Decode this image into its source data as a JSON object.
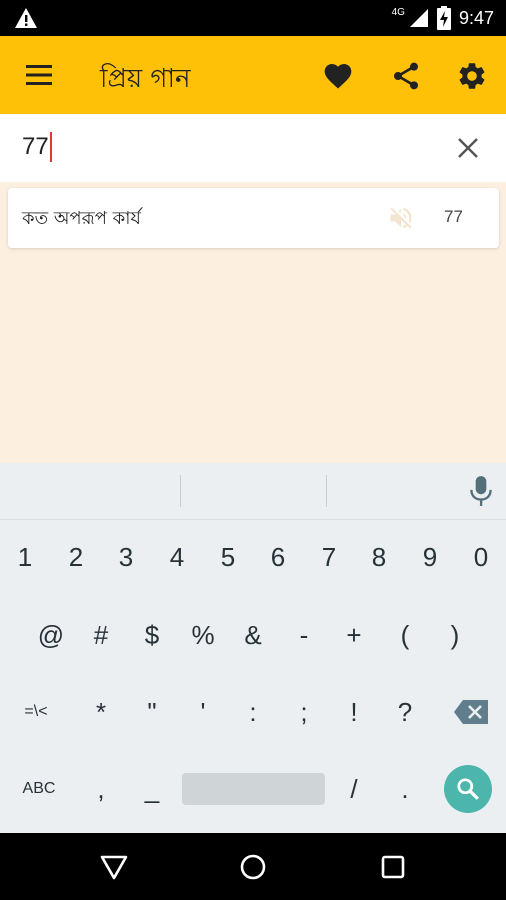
{
  "status_bar": {
    "network": "4G",
    "time": "9:47"
  },
  "app_bar": {
    "title": "প্রিয় গান"
  },
  "search": {
    "value": "77"
  },
  "results": [
    {
      "title": "কত অপরূপ কার্য",
      "number": "77"
    }
  ],
  "keyboard": {
    "row1": [
      "1",
      "2",
      "3",
      "4",
      "5",
      "6",
      "7",
      "8",
      "9",
      "0"
    ],
    "row2": [
      "@",
      "#",
      "$",
      "%",
      "&",
      "-",
      "+",
      "(",
      ")"
    ],
    "row3": [
      "=\\<",
      "*",
      "\"",
      "'",
      ":",
      ";",
      "!",
      "?"
    ],
    "row4_left": "ABC",
    "row4_keys": [
      ",",
      "_",
      "/",
      "."
    ]
  },
  "colors": {
    "app_bar": "#ffc107",
    "background": "#fdefe0",
    "search_key": "#4db6ac"
  }
}
